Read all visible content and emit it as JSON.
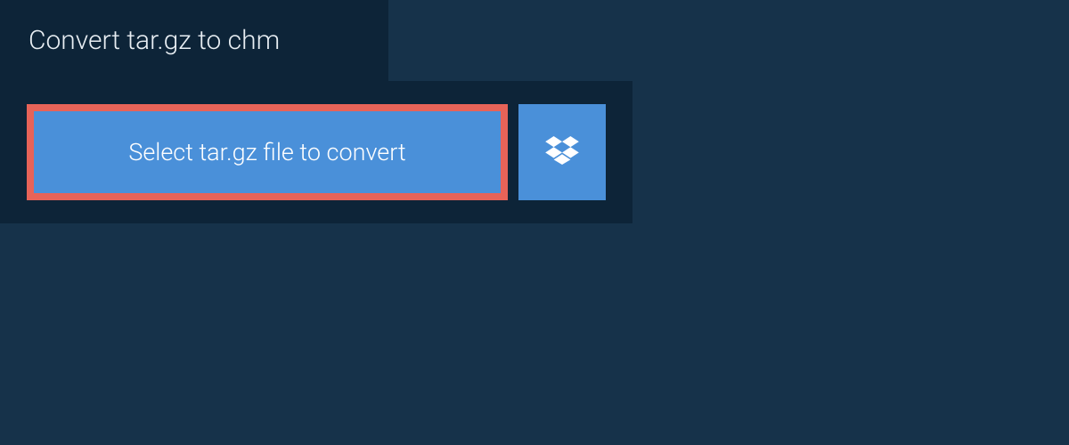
{
  "header": {
    "title": "Convert tar.gz to chm"
  },
  "upload": {
    "select_label": "Select tar.gz file to convert",
    "dropbox_icon": "dropbox"
  },
  "colors": {
    "page_bg": "#16324a",
    "panel_bg": "#0d2438",
    "button_bg": "#4a90d9",
    "highlight_border": "#e76358",
    "text_light": "#e8eef3",
    "text_white": "#ffffff"
  }
}
